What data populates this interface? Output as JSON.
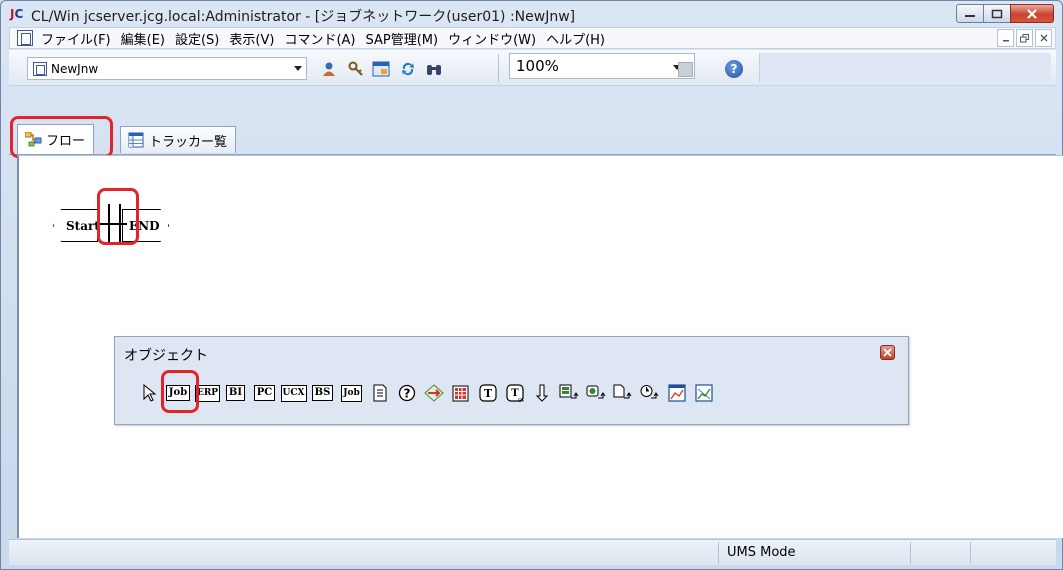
{
  "window": {
    "logo_j": "J",
    "logo_c": "C",
    "title": "CL/Win jcserver.jcg.local:Administrator - [ジョブネットワーク(user01) :NewJnw]"
  },
  "menu": {
    "items": [
      "ファイル(F)",
      "編集(E)",
      "設定(S)",
      "表示(V)",
      "コマンド(A)",
      "SAP管理(M)",
      "ウィンドウ(W)",
      "ヘルプ(H)"
    ]
  },
  "toolbar": {
    "network_combo": "NewJnw",
    "zoom": "100%",
    "icons": [
      "user-icon",
      "key-icon",
      "window-icon",
      "refresh-icon",
      "binoculars-icon"
    ]
  },
  "tabs": [
    {
      "label": "フロー",
      "icon": "flow-icon",
      "active": true
    },
    {
      "label": "トラッカー覧",
      "icon": "tracker-list-icon",
      "active": false
    }
  ],
  "flow": {
    "start_label": "Start",
    "end_label": "END"
  },
  "palette": {
    "title": "オブジェクト",
    "items": [
      {
        "name": "pointer",
        "label": ""
      },
      {
        "name": "job",
        "label": "Job"
      },
      {
        "name": "erp",
        "label": "ERP"
      },
      {
        "name": "bi",
        "label": "BI"
      },
      {
        "name": "pc",
        "label": "PC"
      },
      {
        "name": "ucx",
        "label": "UCX"
      },
      {
        "name": "bs",
        "label": "BS"
      },
      {
        "name": "job-sub",
        "label": "Job"
      }
    ]
  },
  "status": {
    "mode": "UMS Mode"
  },
  "colors": {
    "highlight": "#e3242b",
    "accent": "#1b3f8f"
  }
}
